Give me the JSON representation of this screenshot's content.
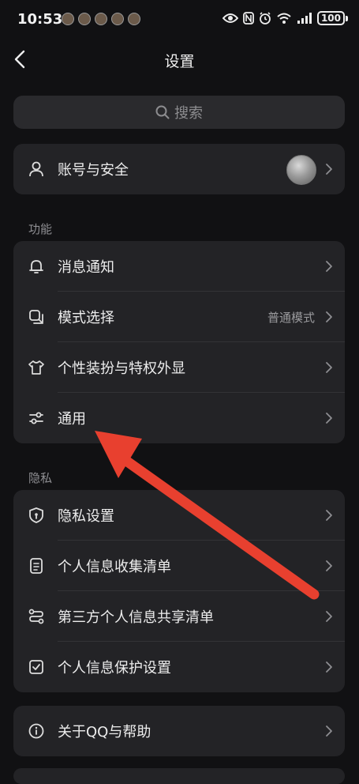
{
  "status_bar": {
    "time": "10:53",
    "battery": "100",
    "app_icons": [
      "app-icon-1",
      "app-icon-2",
      "app-icon-3",
      "app-icon-4",
      "app-icon-5"
    ],
    "right_icons": [
      "eye-icon",
      "nfc-icon",
      "alarm-icon",
      "wifi-icon",
      "signal-icon"
    ]
  },
  "nav": {
    "title": "设置"
  },
  "search": {
    "placeholder": "搜索"
  },
  "account": {
    "label": "账号与安全"
  },
  "sections": {
    "function": {
      "title": "功能",
      "items": [
        {
          "label": "消息通知",
          "icon": "bell-icon"
        },
        {
          "label": "模式选择",
          "value": "普通模式",
          "icon": "mode-icon"
        },
        {
          "label": "个性装扮与特权外显",
          "icon": "tshirt-icon"
        },
        {
          "label": "通用",
          "icon": "sliders-icon"
        }
      ]
    },
    "privacy": {
      "title": "隐私",
      "items": [
        {
          "label": "隐私设置",
          "icon": "shield-icon"
        },
        {
          "label": "个人信息收集清单",
          "icon": "document-icon"
        },
        {
          "label": "第三方个人信息共享清单",
          "icon": "share-icon"
        },
        {
          "label": "个人信息保护设置",
          "icon": "check-box-icon"
        }
      ]
    },
    "about": {
      "items": [
        {
          "label": "关于QQ与帮助",
          "icon": "info-icon"
        }
      ]
    }
  },
  "colors": {
    "background": "#111113",
    "card": "#232326",
    "annotation_arrow": "#e8402f"
  }
}
